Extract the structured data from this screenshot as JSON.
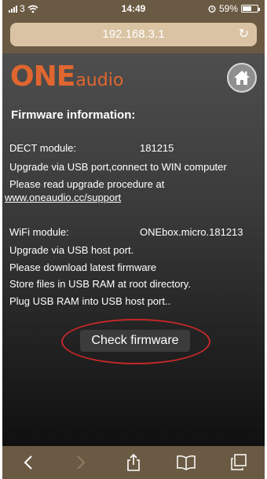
{
  "status_bar": {
    "carrier": "3",
    "time": "14:49",
    "battery": "59%",
    "battery_level": 0.59
  },
  "browser": {
    "url": "192.168.3.1",
    "reload_icon": "reload-icon"
  },
  "page": {
    "logo_one": "ONE",
    "logo_audio": "audio",
    "home_icon": "home-icon",
    "heading": "Firmware information:",
    "dect_label": "DECT module:",
    "dect_value": "181215",
    "dect_line1": "Upgrade via USB port,connect to WIN computer",
    "dect_line2": "Please read upgrade procedure at",
    "support_link": "www.oneaudio.cc/support",
    "wifi_label": "WiFi module:",
    "wifi_value": "ONEbox.micro.181213",
    "wifi_line1": "Upgrade via USB host port.",
    "wifi_line2": "Please download latest firmware",
    "wifi_line3": "Store files in USB RAM at root directory.",
    "wifi_line4": "Plug USB RAM into USB host port..",
    "check_button": "Check firmware"
  },
  "toolbar": {
    "icons": [
      "back-icon",
      "forward-icon",
      "share-icon",
      "bookmarks-icon",
      "tabs-icon"
    ]
  }
}
